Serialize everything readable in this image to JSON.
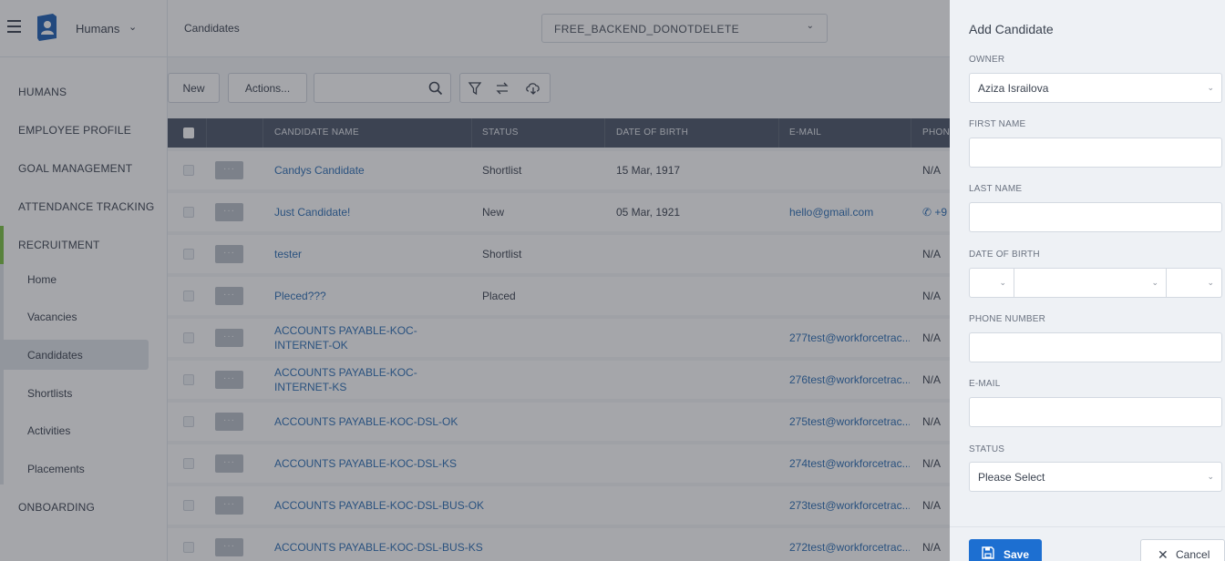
{
  "topbar": {
    "app_name": "Humans",
    "breadcrumb": "Candidates",
    "database": "FREE_BACKEND_DONOTDELETE"
  },
  "sidebar": {
    "items": [
      "HUMANS",
      "EMPLOYEE PROFILE",
      "GOAL MANAGEMENT",
      "ATTENDANCE TRACKING",
      "RECRUITMENT"
    ],
    "recruitment_sub": [
      "Home",
      "Vacancies",
      "Candidates",
      "Shortlists",
      "Activities",
      "Placements"
    ],
    "last_item": "ONBOARDING",
    "accent_color": "#7bc142"
  },
  "toolbar": {
    "new_label": "New",
    "actions_label": "Actions...",
    "search_value": ""
  },
  "table": {
    "headers": [
      "CANDIDATE NAME",
      "STATUS",
      "DATE OF BIRTH",
      "E-MAIL",
      "PHONE"
    ],
    "rows": [
      {
        "name": "Candys Candidate",
        "status": "Shortlist",
        "dob": "15 Mar, 1917",
        "email": "",
        "phone": "N/A"
      },
      {
        "name": "Just Candidate!",
        "status": "New",
        "dob": "05 Mar, 1921",
        "email": "hello@gmail.com",
        "phone": "+9"
      },
      {
        "name": "tester",
        "status": "Shortlist",
        "dob": "",
        "email": "",
        "phone": "N/A"
      },
      {
        "name": "Pleced???",
        "status": "Placed",
        "dob": "",
        "email": "",
        "phone": "N/A"
      },
      {
        "name": "ACCOUNTS PAYABLE-KOC-INTERNET-OK",
        "status": "",
        "dob": "",
        "email": "277test@workforcetrac...",
        "phone": "N/A"
      },
      {
        "name": "ACCOUNTS PAYABLE-KOC-INTERNET-KS",
        "status": "",
        "dob": "",
        "email": "276test@workforcetrac...",
        "phone": "N/A"
      },
      {
        "name": "ACCOUNTS PAYABLE-KOC-DSL-OK",
        "status": "",
        "dob": "",
        "email": "275test@workforcetrac...",
        "phone": "N/A"
      },
      {
        "name": "ACCOUNTS PAYABLE-KOC-DSL-KS",
        "status": "",
        "dob": "",
        "email": "274test@workforcetrac...",
        "phone": "N/A"
      },
      {
        "name": "ACCOUNTS PAYABLE-KOC-DSL-BUS-OK",
        "status": "",
        "dob": "",
        "email": "273test@workforcetrac...",
        "phone": "N/A"
      },
      {
        "name": "ACCOUNTS PAYABLE-KOC-DSL-BUS-KS",
        "status": "",
        "dob": "",
        "email": "272test@workforcetrac...",
        "phone": "N/A"
      }
    ]
  },
  "drawer": {
    "title": "Add Candidate",
    "owner_label": "OWNER",
    "owner_value": "Aziza Israilova",
    "first_name_label": "FIRST NAME",
    "last_name_label": "LAST NAME",
    "dob_label": "DATE OF BIRTH",
    "phone_label": "PHONE NUMBER",
    "email_label": "E-MAIL",
    "status_label": "STATUS",
    "status_value": "Please Select",
    "save_label": "Save",
    "cancel_label": "Cancel",
    "primary_color": "#1d6fd1"
  }
}
